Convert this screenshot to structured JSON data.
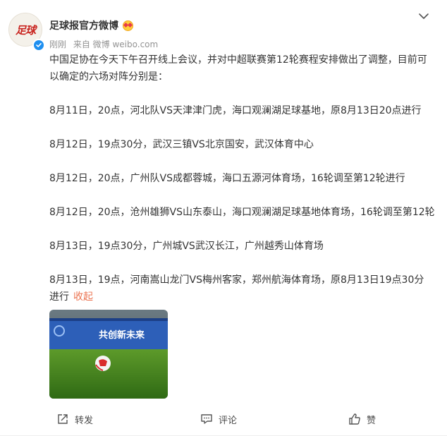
{
  "post": {
    "avatar_text": "足球",
    "author": "足球报官方微博",
    "time": "刚刚",
    "source": "来自 微博 weibo.com",
    "paragraphs": [
      "中国足协在今天下午召开线上会议，并对中超联赛第12轮赛程安排做出了调整，目前可以确定的六场对阵分别是：",
      "8月11日，20点，河北队VS天津津门虎，海口观澜湖足球基地，原8月13日20点进行",
      "8月12日，19点30分，武汉三镇VS北京国安，武汉体育中心",
      "8月12日，20点，广州队VS成都蓉城，海口五源河体育场，16轮调至第12轮进行",
      "8月12日，20点，沧州雄狮VS山东泰山，海口观澜湖足球基地体育场，16轮调至第12轮",
      "8月13日，19点30分，广州城VS武汉长江，广州越秀山体育场",
      "8月13日，19点，河南嵩山龙门VS梅州客家，郑州航海体育场，原8月13日19点30分进行"
    ],
    "collapse_label": "收起",
    "photo_banner": "共创新未来"
  },
  "actions": {
    "repost": "转发",
    "comment": "评论",
    "like": "赞"
  },
  "colors": {
    "accent": "#eb7350",
    "verified": "#1e8ff0",
    "meta": "#939393"
  },
  "icons": [
    "chevron-down-icon",
    "verified-icon",
    "emoji-icon",
    "repost-icon",
    "comment-icon",
    "like-icon"
  ]
}
